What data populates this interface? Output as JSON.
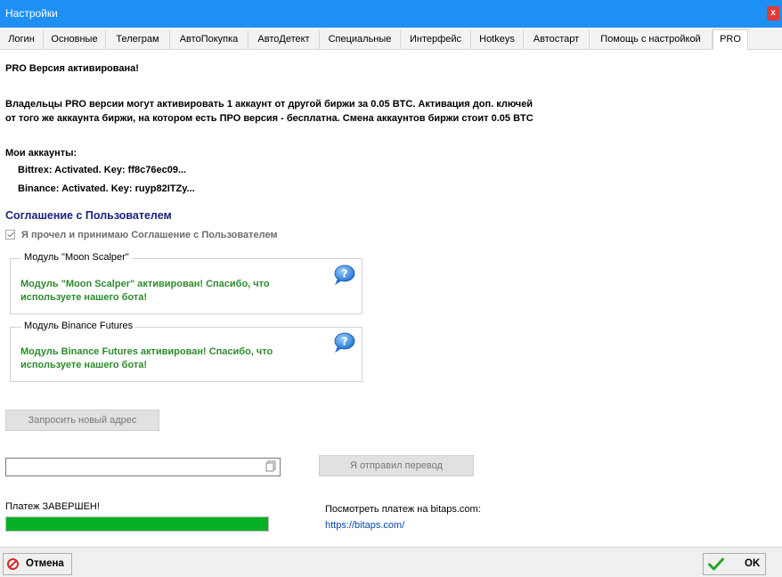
{
  "window": {
    "title": "Настройки",
    "close_label": "x"
  },
  "tabs": [
    {
      "label": "Логин"
    },
    {
      "label": "Основные"
    },
    {
      "label": "Телеграм"
    },
    {
      "label": "АвтоПокупка"
    },
    {
      "label": "АвтоДетект"
    },
    {
      "label": "Специальные"
    },
    {
      "label": "Интерфейс"
    },
    {
      "label": "Hotkeys"
    },
    {
      "label": "Автостарт"
    },
    {
      "label": "Помощь с настройкой"
    },
    {
      "label": "PRO"
    }
  ],
  "active_tab": "PRO",
  "pro": {
    "status": "PRO Версия активирована!",
    "info_line1": "Владельцы PRO версии могут активировать 1 аккаунт от другой биржи за 0.05 BTC. Активация доп. ключей",
    "info_line2": "от того же аккаунта биржи, на котором есть ПРО версия - бесплатна. Смена аккаунтов биржи стоит 0.05 BTC",
    "accounts_heading": "Мои аккаунты:",
    "accounts": [
      {
        "text": "Bittrex: Activated.  Key: ff8c76ec09..."
      },
      {
        "text": "Binance: Activated.  Key: ruyp82ITZy..."
      }
    ]
  },
  "agreement": {
    "heading": "Соглашение с Пользователем",
    "checkbox_label": "Я прочел и принимаю Соглашение с Пользователем",
    "checked": true
  },
  "modules": [
    {
      "title": "Модуль \"Moon Scalper\"",
      "message_line1": "Модуль \"Moon Scalper\" активирован! Спасибо, что",
      "message_line2": "используете нашего бота!"
    },
    {
      "title": "Модуль Binance Futures",
      "message_line1": "Модуль Binance Futures активирован! Спасибо, что",
      "message_line2": "используете нашего бота!"
    }
  ],
  "payment": {
    "request_address_label": "Запросить новый адрес",
    "address_value": "",
    "sent_button_label": "Я отправил перевод",
    "status_text": "Платеж ЗАВЕРШЕН!",
    "progress_percent": 100,
    "view_label": "Посмотреть платеж на bitaps.com:",
    "view_link": "https://bitaps.com/"
  },
  "footer": {
    "cancel_label": "Отмена",
    "ok_label": "OK"
  },
  "colors": {
    "titlebar": "#1e90f4",
    "agreement_heading": "#1a237e",
    "module_message": "#2e8b2e",
    "progress_fill": "#06b025",
    "link": "#0645ad",
    "close": "#e53935"
  },
  "icons": [
    "close-icon",
    "help-bubble-icon",
    "copy-icon",
    "cancel-icon",
    "checkmark-icon"
  ]
}
